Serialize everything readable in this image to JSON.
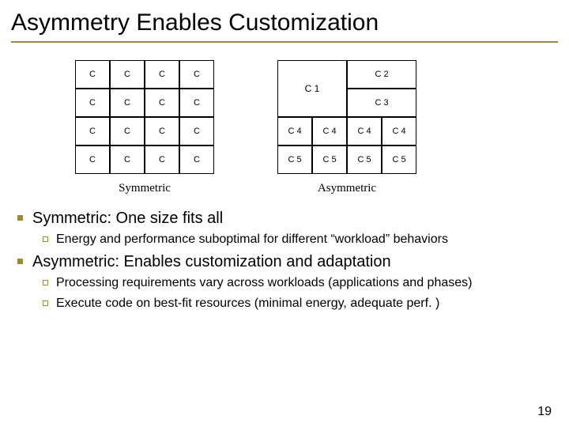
{
  "title": "Asymmetry Enables Customization",
  "symmetric": {
    "cells": [
      [
        "C",
        "C",
        "C",
        "C"
      ],
      [
        "C",
        "C",
        "C",
        "C"
      ],
      [
        "C",
        "C",
        "C",
        "C"
      ],
      [
        "C",
        "C",
        "C",
        "C"
      ]
    ],
    "caption": "Symmetric"
  },
  "asymmetric": {
    "c1": "C 1",
    "c2": "C 2",
    "c3": "C 3",
    "row3": [
      "C 4",
      "C 4",
      "C 4",
      "C 4"
    ],
    "row4": [
      "C 5",
      "C 5",
      "C 5",
      "C 5"
    ],
    "caption": "Asymmetric"
  },
  "bullets": {
    "b1": "Symmetric: One size fits all",
    "b1_1": "Energy and performance suboptimal for different “workload” behaviors",
    "b2": "Asymmetric: Enables customization and adaptation",
    "b2_1": "Processing requirements vary across workloads (applications and phases)",
    "b2_2": "Execute code on best-fit resources (minimal energy, adequate perf. )"
  },
  "pagenum": "19"
}
